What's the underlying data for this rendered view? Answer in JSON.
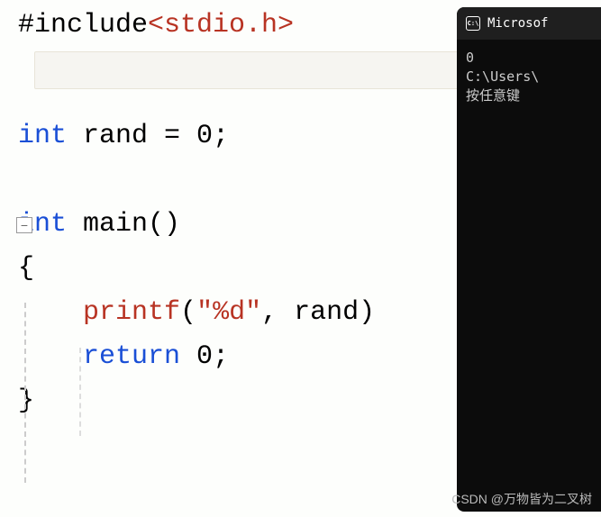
{
  "editor": {
    "line1": {
      "include": "#include",
      "header": "<stdio.h>"
    },
    "line2": {
      "kw": "int",
      "decl": " rand = 0;"
    },
    "line3": {
      "kw": "int",
      "name": " main",
      "parens": "()"
    },
    "brace_open": "{",
    "line4": {
      "indent": "    ",
      "func": "printf",
      "open": "(",
      "str": "\"%d\"",
      "rest": ", rand)"
    },
    "line5": {
      "indent": "    ",
      "kw": "return",
      "rest": " 0;"
    },
    "brace_close": "}",
    "fold_symbol": "−"
  },
  "terminal": {
    "title": "Microsof",
    "icon_label": "C:\\",
    "output_line1": "0",
    "output_line2": "C:\\Users\\",
    "output_line3": "按任意键"
  },
  "watermark": "CSDN @万物皆为二叉树"
}
